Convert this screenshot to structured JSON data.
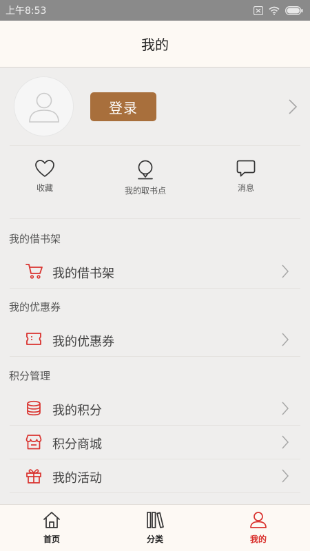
{
  "status_bar": {
    "time": "上午8:53"
  },
  "header": {
    "title": "我的"
  },
  "profile": {
    "login_label": "登录"
  },
  "quick_links": [
    {
      "label": "收藏",
      "icon": "heart-icon"
    },
    {
      "label": "我的取书点",
      "icon": "location-pin-icon"
    },
    {
      "label": "消息",
      "icon": "message-bubble-icon"
    }
  ],
  "sections": [
    {
      "title": "我的借书架",
      "items": [
        {
          "label": "我的借书架",
          "icon": "cart-icon"
        }
      ]
    },
    {
      "title": "我的优惠券",
      "items": [
        {
          "label": "我的优惠券",
          "icon": "ticket-icon"
        }
      ]
    },
    {
      "title": "积分管理",
      "items": [
        {
          "label": "我的积分",
          "icon": "coins-icon"
        },
        {
          "label": "积分商城",
          "icon": "store-icon"
        },
        {
          "label": "我的活动",
          "icon": "gift-icon"
        }
      ]
    }
  ],
  "tab_bar": {
    "tabs": [
      {
        "label": "首页",
        "icon": "home-icon"
      },
      {
        "label": "分类",
        "icon": "books-icon"
      },
      {
        "label": "我的",
        "icon": "user-icon"
      }
    ],
    "active": "我的"
  },
  "colors": {
    "accent": "#d9322e",
    "login_button": "#a86f3c",
    "header_bg": "#fdf9f4",
    "page_bg": "#efeeed"
  }
}
